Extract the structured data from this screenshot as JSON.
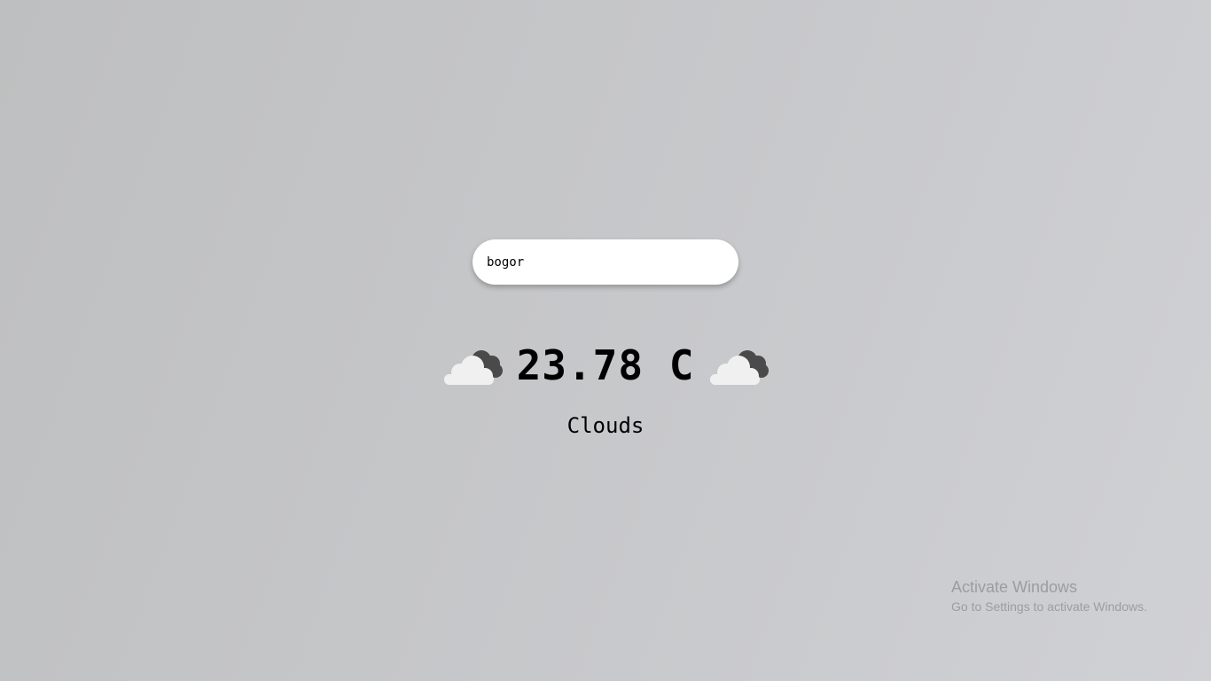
{
  "search": {
    "value": "bogor",
    "icon": "cloud-icon"
  },
  "weather": {
    "temperature": "23.78 C",
    "condition": "Clouds",
    "icon": "cloud-partly-dark"
  },
  "watermark": {
    "title": "Activate Windows",
    "subtitle": "Go to Settings to activate Windows."
  },
  "colors": {
    "background": "#c4c5c7",
    "cloud_light": "#f0f0f0",
    "cloud_dark": "#4a4a4a"
  }
}
